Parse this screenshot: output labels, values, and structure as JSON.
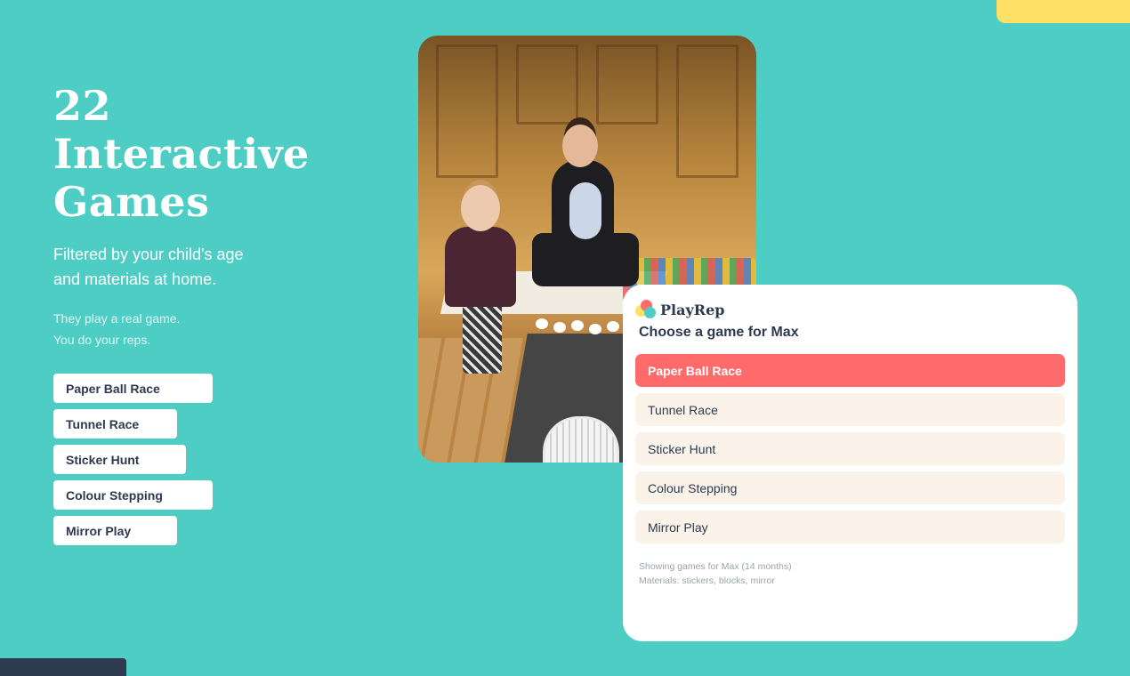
{
  "hero": {
    "title_line1": "22",
    "title_line2": "Interactive",
    "title_line3": "Games",
    "subtitle_line1": "Filtered by your child's age",
    "subtitle_line2": "and materials at home.",
    "tagline_line1": "They play a real game.",
    "tagline_line2": "You do your reps."
  },
  "pills": [
    {
      "label": "Paper Ball Race"
    },
    {
      "label": "Tunnel Race"
    },
    {
      "label": "Sticker Hunt"
    },
    {
      "label": "Colour Stepping"
    },
    {
      "label": "Mirror Play"
    }
  ],
  "card": {
    "brand": "PlayRep",
    "title": "Choose a game for Max",
    "games": [
      {
        "label": "Paper Ball Race",
        "selected": true
      },
      {
        "label": "Tunnel Race",
        "selected": false
      },
      {
        "label": "Sticker Hunt",
        "selected": false
      },
      {
        "label": "Colour Stepping",
        "selected": false
      },
      {
        "label": "Mirror Play",
        "selected": false
      }
    ],
    "meta_line1": "Showing games for Max (14 months)",
    "meta_line2": "Materials: stickers, blocks, mirror"
  },
  "colors": {
    "background": "#4ecdc4",
    "accent_coral": "#ff6b6b",
    "accent_yellow": "#ffe066",
    "navy": "#2d3a4f",
    "cream": "#fbf3e9"
  }
}
